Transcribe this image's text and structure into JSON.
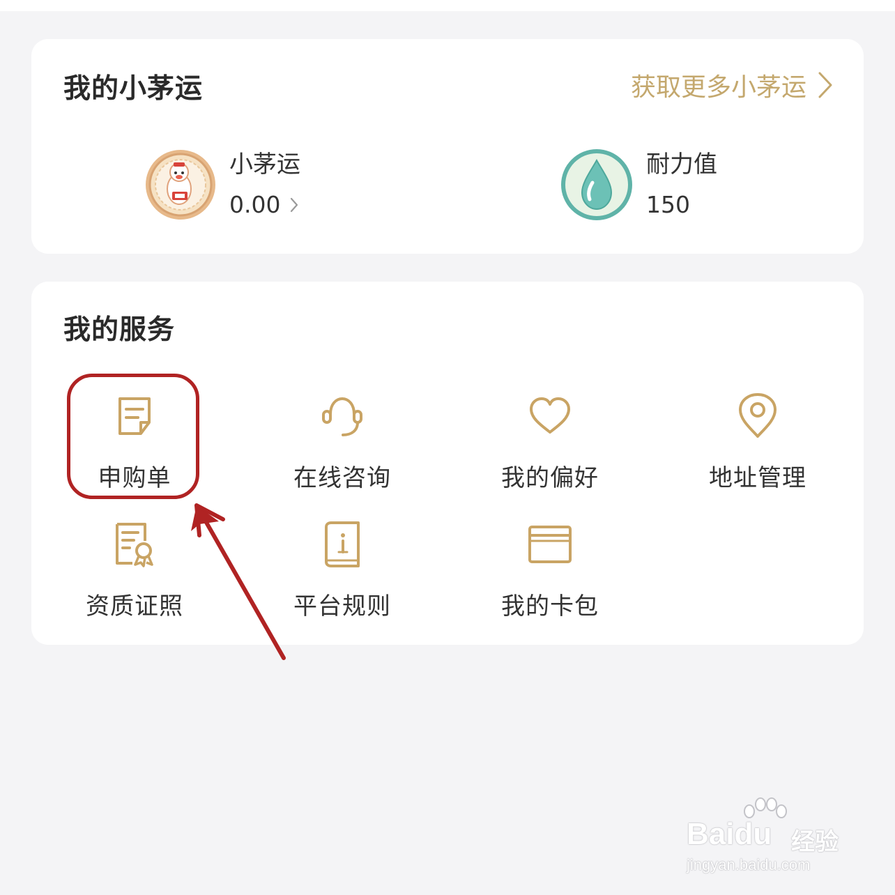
{
  "colors": {
    "page_background": "#f4f4f6",
    "card_background": "#ffffff",
    "accent_gold": "#c4a86e",
    "icon_stroke": "#c9a464",
    "annotation_red": "#b02323",
    "text_primary": "#2a2a2a"
  },
  "fortune_card": {
    "title": "我的小茅运",
    "more_link_label": "获取更多小茅运",
    "more_link_icon": "chevron-right-icon",
    "stats": [
      {
        "label": "小茅运",
        "value": "0.00",
        "icon": "xiaomaoyun-coin-icon",
        "has_chevron": true
      },
      {
        "label": "耐力值",
        "value": "150",
        "icon": "water-drop-icon",
        "has_chevron": false
      }
    ]
  },
  "services_card": {
    "title": "我的服务",
    "items": [
      {
        "label": "申购单",
        "icon": "document-icon",
        "highlighted": true
      },
      {
        "label": "在线咨询",
        "icon": "headset-icon"
      },
      {
        "label": "我的偏好",
        "icon": "heart-icon"
      },
      {
        "label": "地址管理",
        "icon": "location-pin-icon"
      },
      {
        "label": "资质证照",
        "icon": "certificate-icon"
      },
      {
        "label": "平台规则",
        "icon": "info-book-icon"
      },
      {
        "label": "我的卡包",
        "icon": "card-wallet-icon"
      }
    ]
  },
  "annotation": {
    "type": "circle-and-arrow",
    "target": "申购单"
  },
  "watermark": {
    "brand": "Baidu",
    "label_cn": "经验",
    "url": "jingyan.baidu.com"
  }
}
